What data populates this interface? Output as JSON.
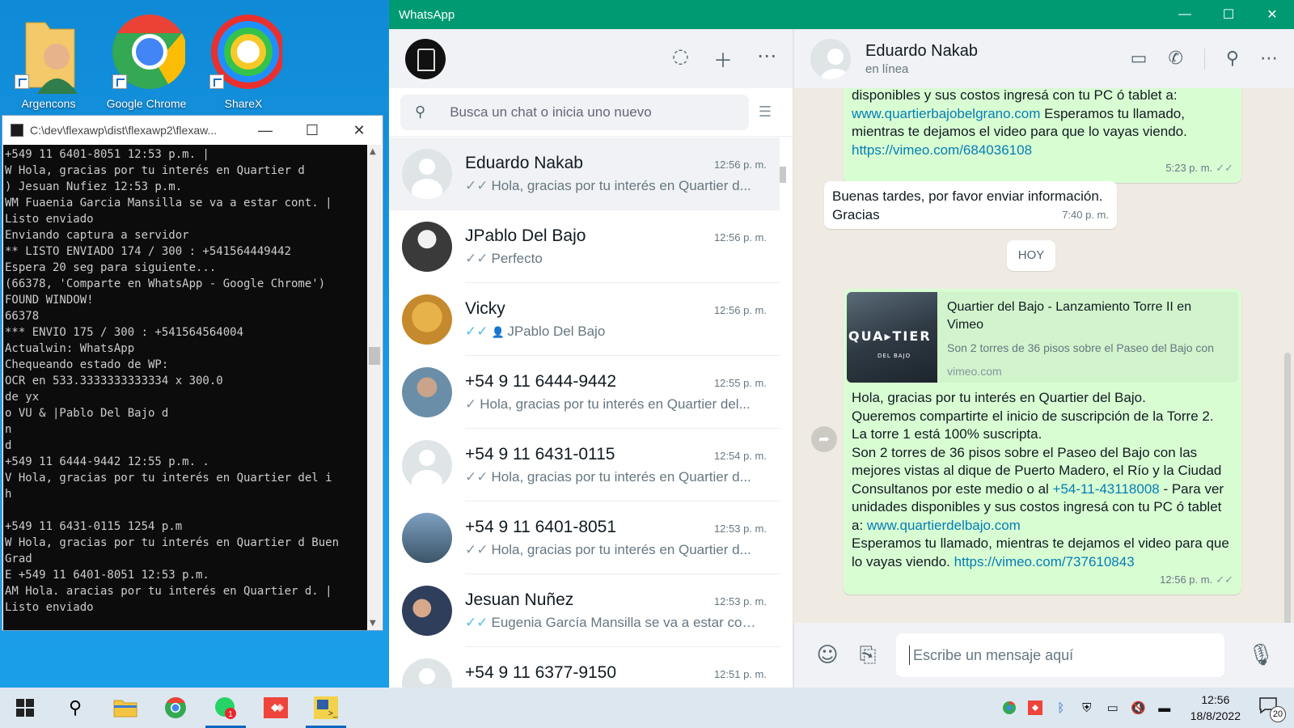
{
  "desktop": {
    "icons": [
      {
        "label": "Argencons",
        "icon": "user-folder-icon"
      },
      {
        "label": "Google Chrome",
        "icon": "chrome-icon"
      },
      {
        "label": "ShareX",
        "icon": "sharex-icon"
      }
    ]
  },
  "console": {
    "title": "C:\\dev\\flexawp\\dist\\flexawp2\\flexaw...",
    "lines": [
      "+549 11 6401-8051 12:53 p.m. |",
      "W Hola, gracias por tu interés en Quartier d",
      ") Jesuan Nufiez 12:53 p.m.",
      "WM Fuaenia Garcia Mansilla se va a estar cont. |",
      "Listo enviado",
      "Enviando captura a servidor",
      "** LISTO ENVIADO 174 / 300 : +541564449442",
      "Espera 20 seg para siguiente...",
      "(66378, 'Comparte en WhatsApp - Google Chrome')",
      "FOUND WINDOW!",
      "66378",
      "*** ENVIO 175 / 300 : +541564564004",
      "Actualwin: WhatsApp",
      "Chequeando estado de WP:",
      "OCR en 533.3333333333334 x 300.0",
      "de yx",
      "o VU & |Pablo Del Bajo d",
      "n",
      "d",
      "+549 11 6444-9442 12:55 p.m. .",
      "V Hola, gracias por tu interés en Quartier del i",
      "h",
      "",
      "+549 11 6431-0115 1254 p.m",
      "W Hola, gracias por tu interés en Quartier d Buen",
      "Grad",
      "E +549 11 6401-8051 12:53 p.m.",
      "AM Hola. aracias por tu interés en Quartier d. |",
      "Listo enviado"
    ]
  },
  "whatsapp": {
    "title": "WhatsApp",
    "search_placeholder": "Busca un chat o inicia uno nuevo",
    "chats": [
      {
        "name": "Eduardo Nakab",
        "time": "12:56 p. m.",
        "preview": "Hola, gracias por tu interés en Quartier d...",
        "tick": "✓✓",
        "tick_color": "#8696a0",
        "active": true
      },
      {
        "name": "JPablo Del Bajo",
        "time": "12:56 p. m.",
        "preview": "Perfecto",
        "tick": "✓✓",
        "tick_color": "#8696a0"
      },
      {
        "name": "Vicky",
        "time": "12:56 p. m.",
        "preview": "JPablo Del Bajo",
        "tick": "✓✓",
        "tick_color": "#53bdeb"
      },
      {
        "name": "+54 9 11 6444-9442",
        "time": "12:55 p. m.",
        "preview": "Hola, gracias por tu interés en Quartier del...",
        "tick": "✓",
        "tick_color": "#8696a0"
      },
      {
        "name": "+54 9 11 6431-0115",
        "time": "12:54 p. m.",
        "preview": "Hola, gracias por tu interés en Quartier d...",
        "tick": "✓✓",
        "tick_color": "#8696a0"
      },
      {
        "name": "+54 9 11 6401-8051",
        "time": "12:53 p. m.",
        "preview": "Hola, gracias por tu interés en Quartier d...",
        "tick": "✓✓",
        "tick_color": "#8696a0"
      },
      {
        "name": "Jesuan Nuñez",
        "time": "12:53 p. m.",
        "preview": "Eugenia García Mansilla se va a estar cont...",
        "tick": "✓✓",
        "tick_color": "#53bdeb"
      },
      {
        "name": "+54 9 11 6377-9150",
        "time": "12:51 p. m.",
        "preview": "",
        "tick": "",
        "tick_color": "#8696a0"
      }
    ],
    "conversation": {
      "contact_name": "Eduardo Nakab",
      "status": "en línea",
      "msg1": {
        "line1": "disponibles y sus costos ingresá con tu PC ó tablet a:",
        "link1": "www.quartierbajobelgrano.com",
        "line2": " Esperamos tu llamado,",
        "line3": "mientras te dejamos el video para que lo vayas viendo.",
        "link2": "https://vimeo.com/684036108",
        "time": "5:23 p. m."
      },
      "msg2": {
        "line1": "Buenas tardes, por favor enviar información.",
        "line2": "Gracias",
        "time": "7:40 p. m."
      },
      "day_label": "HOY",
      "msg3": {
        "preview_title": "Quartier del Bajo - Lanzamiento Torre II en Vimeo",
        "preview_desc": "Son 2 torres de 36 pisos sobre el Paseo del Bajo con",
        "preview_domain": "vimeo.com",
        "thumb_text": "QUA▸TIER",
        "thumb_sub": "DEL BAJO",
        "p1": "Hola, gracias por tu interés en Quartier del Bajo.",
        "p2": "Queremos compartirte el inicio de suscripción de la Torre 2.",
        "p3": "La torre 1 está 100% suscripta.",
        "p4": "Son 2 torres de 36 pisos sobre el Paseo del Bajo con las mejores vistas al dique de Puerto Madero, el Río y la Ciudad",
        "p5a": "Consultanos por este medio o al ",
        "phone": "+54-11-43118008",
        "p5b": " - Para ver unidades disponibles y sus costos ingresá con tu PC ó tablet a: ",
        "link1": "www.quartierdelbajo.com",
        "p6a": "Esperamos tu llamado, mientras te dejamos el video para que lo vayas viendo. ",
        "link2": "https://vimeo.com/737610843",
        "time": "12:56 p. m."
      },
      "composer_placeholder": "Escribe un mensaje aquí"
    }
  },
  "taskbar": {
    "time": "12:56",
    "date": "18/8/2022",
    "notif_count": "20",
    "whatsapp_badge": "1"
  }
}
